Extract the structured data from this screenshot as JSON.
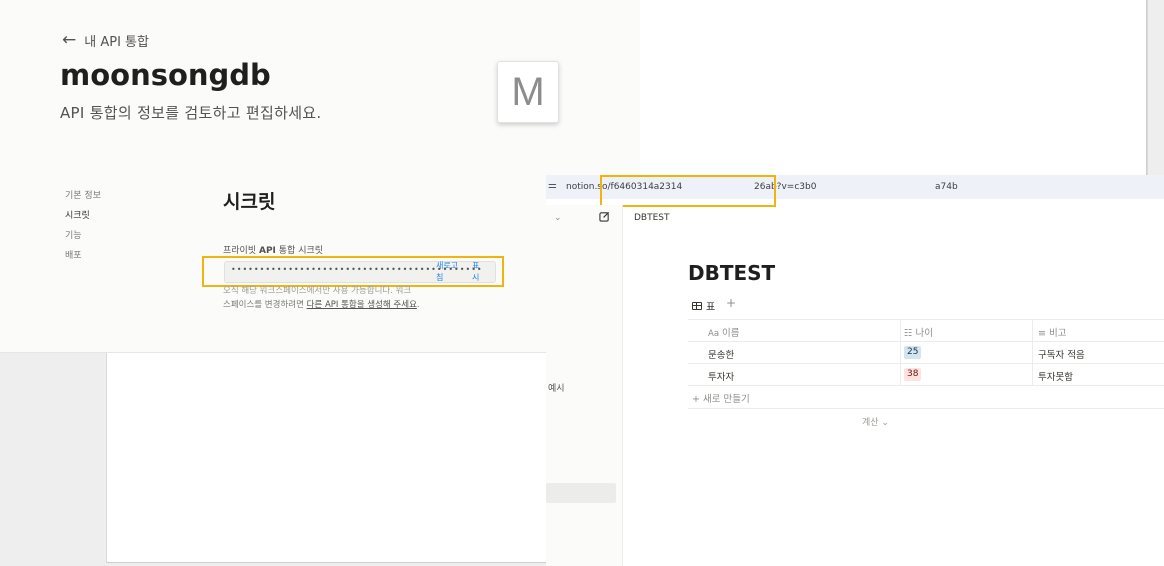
{
  "settings": {
    "back_label": "내 API 통합",
    "title": "moonsongdb",
    "subtitle": "API 통합의 정보를 검토하고 편집하세요.",
    "avatar_letter": "M",
    "nav": [
      "기본 정보",
      "시크릿",
      "기능",
      "배포"
    ],
    "section_title": "시크릿",
    "secret_label_pre": "프라이빗 ",
    "secret_label_bold": "API",
    "secret_label_post": " 통합 시크릿",
    "secret_masked": "••••••••••••••••••••••••••••••••••••••••••••",
    "refresh_label": "새로고침",
    "show_label": "표시",
    "note_line1": "오직 해당 워크스페이스에서만 사용 가능합니다. 워크",
    "note_line2_pre": "스페이스를 변경하려면 ",
    "note_link": "다른 API 통합을 생성해 주세요",
    "note_line2_post": "."
  },
  "notion": {
    "url_part1": "notion.so/f6460314a2314",
    "url_part2": "26ab?v=c3b0",
    "url_part3": "a74b",
    "sidebar_item": "예시",
    "breadcrumb": "DBTEST",
    "title": "DBTEST",
    "view_label": "표",
    "columns": [
      {
        "icon": "Aa",
        "label": "이름"
      },
      {
        "icon": "list-icon",
        "label": "나이"
      },
      {
        "icon": "text-icon",
        "label": "비고"
      }
    ],
    "rows": [
      {
        "name": "문송한",
        "age": "25",
        "age_color": "#d3e5ef",
        "note": "구독자 적음"
      },
      {
        "name": "투자자",
        "age": "38",
        "age_color": "#ffe2dd",
        "note": "투자못함"
      }
    ],
    "new_label": "새로 만들기",
    "calc_label": "계산"
  },
  "colors": {
    "highlight": "#f1b30f",
    "link": "#2383e2"
  }
}
